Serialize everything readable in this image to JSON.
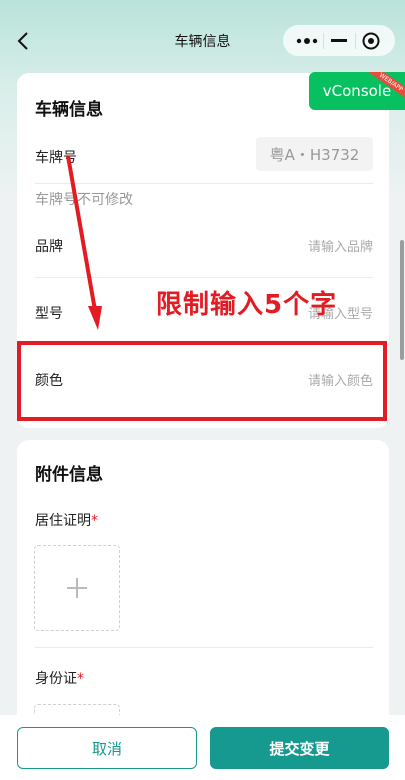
{
  "navbar": {
    "title": "车辆信息"
  },
  "vconsole": {
    "label": "vConsole",
    "ribbon": "WEB/APP"
  },
  "vehicle_card": {
    "title": "车辆信息",
    "plate_label": "车牌号",
    "plate_value": "粤A・H3732",
    "plate_hint": "车牌号不可修改",
    "brand_label": "品牌",
    "brand_placeholder": "请输入品牌",
    "model_label": "型号",
    "model_placeholder": "请输入型号",
    "color_label": "颜色",
    "color_placeholder": "请输入颜色"
  },
  "annotation": {
    "text": "限制输入5个字"
  },
  "attachment_card": {
    "title": "附件信息",
    "residence_label": "居住证明",
    "id_label": "身份证",
    "required_mark": "*"
  },
  "actions": {
    "cancel_label": "取消",
    "submit_label": "提交变更"
  },
  "colors": {
    "accent": "#16998f",
    "annotation": "#e31b23",
    "vconsole": "#07c160"
  }
}
